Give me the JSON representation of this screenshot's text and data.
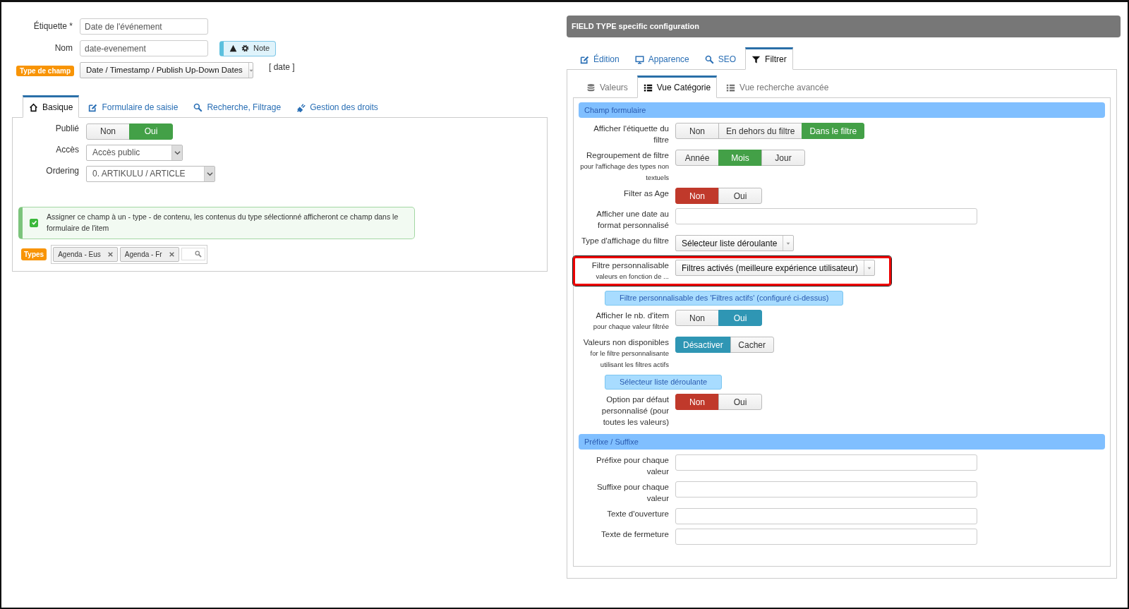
{
  "left": {
    "fields": [
      {
        "label": "Étiquette *",
        "value": "Date de l'événement"
      },
      {
        "label": "Nom",
        "value": "date-evenement"
      }
    ],
    "note_button": "Note",
    "field_type": {
      "label": "Type de champ",
      "value": "Date / Timestamp / Publish Up-Down Dates",
      "hint": "[ date ]"
    },
    "tabs": [
      {
        "label": "Basique",
        "selected": true
      },
      {
        "label": "Formulaire de saisie",
        "selected": false
      },
      {
        "label": "Recherche, Filtrage",
        "selected": false
      },
      {
        "label": "Gestion des droits",
        "selected": false
      }
    ],
    "rows": [
      {
        "kind": "toggle",
        "label": "Publié",
        "color": "#43a047",
        "options": [
          {
            "label": "Non",
            "selected": false
          },
          {
            "label": "Oui",
            "selected": true
          }
        ]
      },
      {
        "kind": "select",
        "label": "Accès",
        "value": "Accès public"
      },
      {
        "kind": "select",
        "label": "Ordering",
        "value": "0. ARTIKULU / ARTICLE"
      }
    ],
    "alert": {
      "text": "Assigner ce champ à un - type - de contenu, les contenus du type sélectionné afficheront ce champ dans le formulaire de l'item",
      "checked": true
    },
    "types": {
      "label": "Types",
      "tags": [
        "Agenda - Eus",
        "Agenda - Fr"
      ]
    }
  },
  "right": {
    "header": "FIELD TYPE specific configuration",
    "tabs": [
      {
        "label": "Édition",
        "selected": false
      },
      {
        "label": "Apparence",
        "selected": false
      },
      {
        "label": "SEO",
        "selected": false
      },
      {
        "label": "Filtrer",
        "selected": true
      }
    ],
    "subtabs": [
      {
        "label": "Valeurs",
        "selected": false
      },
      {
        "label": "Vue Catégorie",
        "selected": true
      },
      {
        "label": "Vue recherche avancée",
        "selected": false
      }
    ],
    "sections": [
      {
        "title": "Champ formulaire",
        "rows": [
          {
            "kind": "toggle",
            "label": "Afficher l'étiquette du filtre",
            "color": "#43a047",
            "options": [
              {
                "label": "Non",
                "selected": false
              },
              {
                "label": "En dehors du filtre",
                "selected": false
              },
              {
                "label": "Dans le filtre",
                "selected": true
              }
            ]
          },
          {
            "kind": "toggle",
            "label": "Regroupement de filtre",
            "sublabel": "pour l'affichage des types non textuels",
            "color": "#43a047",
            "options": [
              {
                "label": "Année",
                "selected": false
              },
              {
                "label": "Mois",
                "selected": true
              },
              {
                "label": "Jour",
                "selected": false
              }
            ]
          },
          {
            "kind": "toggle",
            "label": "Filter as Age",
            "color": "#c0392b",
            "options": [
              {
                "label": "Non",
                "selected": true
              },
              {
                "label": "Oui",
                "selected": false
              }
            ]
          },
          {
            "kind": "text",
            "label": "Afficher une date au format personnalisé"
          },
          {
            "kind": "select",
            "label": "Type d'affichage du filtre",
            "value": "Sélecteur liste déroulante"
          },
          {
            "kind": "select",
            "label": "Filtre personnalisable",
            "sublabel": "valeurs en fonction de ...",
            "value": "Filtres activés (meilleure expérience utilisateur)",
            "highlighted": true
          },
          {
            "kind": "note",
            "label": "Filtre personnalisable des 'Filtres actifs' (configuré ci-dessus)"
          },
          {
            "kind": "toggle",
            "label": "Afficher le nb. d'item",
            "sublabel": "pour chaque valeur filtrée",
            "color": "#2f96b4",
            "options": [
              {
                "label": "Non",
                "selected": false
              },
              {
                "label": "Oui",
                "selected": true
              }
            ]
          },
          {
            "kind": "toggle",
            "label": "Valeurs non disponibles",
            "sublabel": "for le filtre personnalisante utilisant les filtres actifs",
            "color": "#2f96b4",
            "options": [
              {
                "label": "Désactiver",
                "selected": true
              },
              {
                "label": "Cacher",
                "selected": false
              }
            ]
          },
          {
            "kind": "note",
            "label": "Sélecteur liste déroulante"
          },
          {
            "kind": "toggle",
            "label": "Option par défaut personnalisé (pour toutes les valeurs)",
            "color": "#c0392b",
            "options": [
              {
                "label": "Non",
                "selected": true
              },
              {
                "label": "Oui",
                "selected": false
              }
            ]
          }
        ]
      },
      {
        "title": "Préfixe / Suffixe",
        "rows": [
          {
            "kind": "text",
            "label": "Préfixe pour chaque valeur"
          },
          {
            "kind": "text",
            "label": "Suffixe pour chaque valeur"
          },
          {
            "kind": "text",
            "label": "Texte d'ouverture"
          },
          {
            "kind": "text",
            "label": "Texte de fermeture"
          }
        ]
      }
    ]
  }
}
